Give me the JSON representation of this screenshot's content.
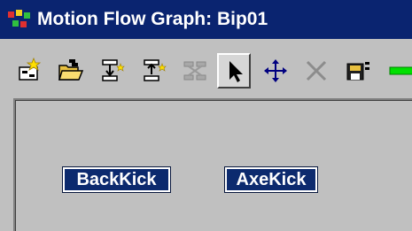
{
  "window": {
    "title": "Motion Flow Graph: Bip01"
  },
  "toolbar": {
    "buttons": [
      {
        "icon": "create-motion-flow-icon"
      },
      {
        "icon": "open-folder-icon"
      },
      {
        "icon": "add-transition-icon"
      },
      {
        "icon": "insert-transition-icon"
      },
      {
        "icon": "optimize-transitions-icon"
      },
      {
        "icon": "select-arrow-icon",
        "pressed": true
      },
      {
        "icon": "move-cross-icon"
      },
      {
        "icon": "delete-x-icon"
      },
      {
        "icon": "save-file-icon"
      },
      {
        "icon": "green-bar-icon"
      }
    ]
  },
  "graph": {
    "nodes": [
      {
        "label": "BackKick"
      },
      {
        "label": "AxeKick"
      }
    ]
  },
  "colors": {
    "titlebar": "#0a2470",
    "node": "#0c2a6e",
    "background": "#c0c0c0"
  }
}
